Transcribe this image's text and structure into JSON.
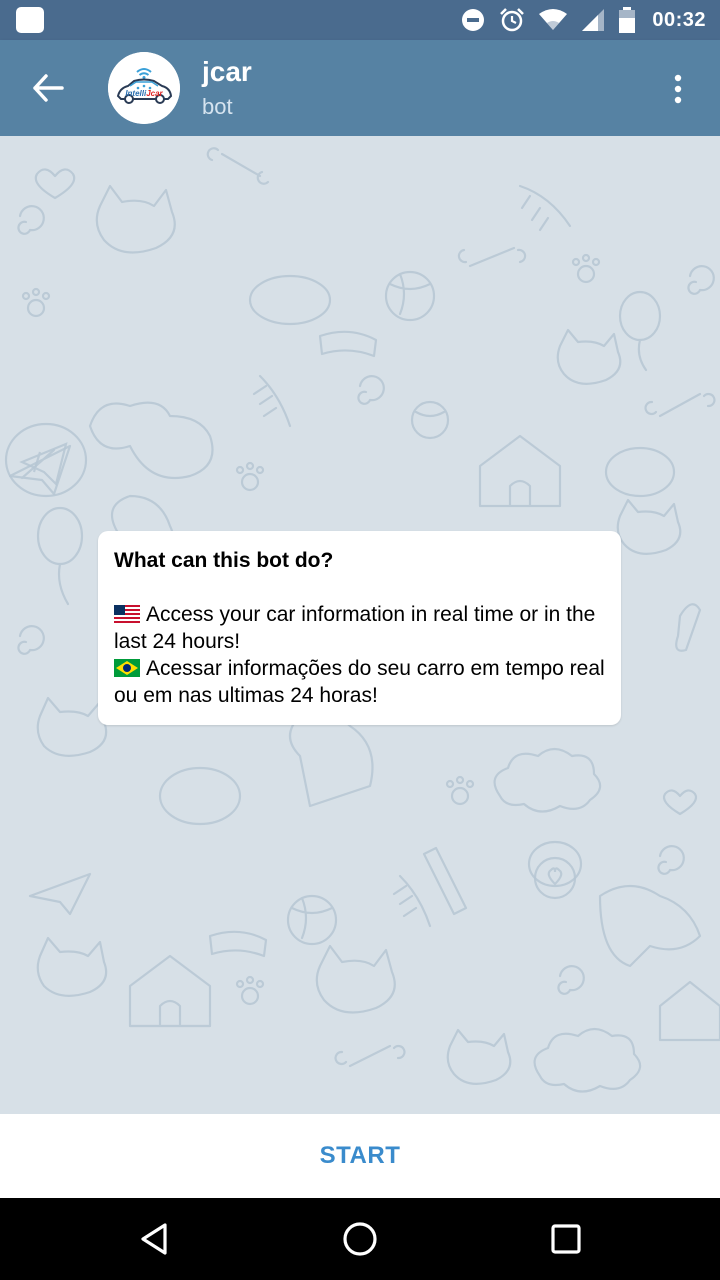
{
  "status_bar": {
    "time": "00:32",
    "icons": [
      "app-notification-icon",
      "do-not-disturb-icon",
      "alarm-icon",
      "wifi-icon",
      "signal-icon",
      "battery-icon"
    ]
  },
  "header": {
    "title": "jcar",
    "subtitle": "bot",
    "avatar_text": "IntelliJcar",
    "colors": {
      "app_bar": "#5682a3",
      "status_bar": "#4a6b8e"
    }
  },
  "bot_info": {
    "title": "What can this bot do?",
    "line_en": "Access your car information in real time or in the last 24 hours!",
    "line_pt": "Acessar informações do seu carro em tempo real ou em nas ultimas 24 horas!",
    "flag_en": "us-flag-icon",
    "flag_pt": "brazil-flag-icon"
  },
  "bottom": {
    "start_label": "START",
    "accent": "#3a8bcc"
  },
  "nav": {
    "icons": [
      "back-triangle-icon",
      "home-circle-icon",
      "recents-square-icon"
    ]
  }
}
